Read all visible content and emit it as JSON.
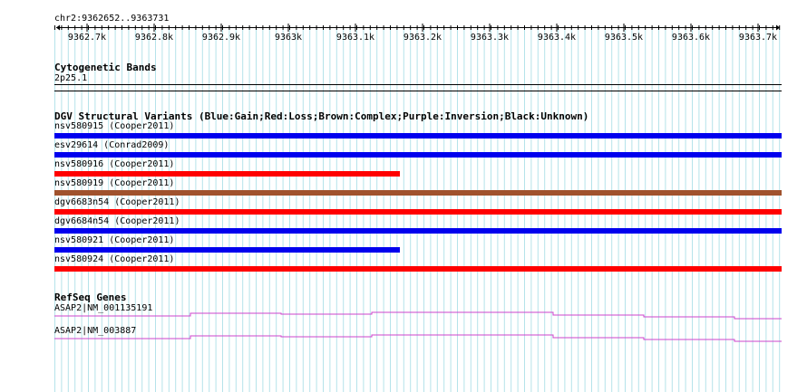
{
  "region": {
    "label": "chr2:9362652..9363731",
    "ticks": [
      "9362.7k",
      "9362.8k",
      "9362.9k",
      "9363k",
      "9363.1k",
      "9363.2k",
      "9363.3k",
      "9363.4k",
      "9363.5k",
      "9363.6k",
      "9363.7k"
    ]
  },
  "cytoband": {
    "title": "Cytogenetic Bands",
    "band": "2p25.1"
  },
  "dgv": {
    "title": "DGV Structural Variants (Blue:Gain;Red:Loss;Brown:Complex;Purple:Inversion;Black:Unknown)",
    "colors": {
      "Gain": "#0000ee",
      "Loss": "#ff0000",
      "Complex": "#a0522d"
    },
    "variants": [
      {
        "label": "nsv580915 (Cooper2011)",
        "type": "Gain",
        "extent": 1.0
      },
      {
        "label": "esv29614 (Conrad2009)",
        "type": "Gain",
        "extent": 1.0
      },
      {
        "label": "nsv580916 (Cooper2011)",
        "type": "Loss",
        "extent": 0.475
      },
      {
        "label": "nsv580919 (Cooper2011)",
        "type": "Complex",
        "extent": 1.0
      },
      {
        "label": "dgv6683n54 (Cooper2011)",
        "type": "Loss",
        "extent": 1.0
      },
      {
        "label": "dgv6684n54 (Cooper2011)",
        "type": "Gain",
        "extent": 1.0
      },
      {
        "label": "nsv580921 (Cooper2011)",
        "type": "Gain",
        "extent": 0.475
      },
      {
        "label": "nsv580924 (Cooper2011)",
        "type": "Loss",
        "extent": 1.0
      }
    ]
  },
  "refseq": {
    "title": "RefSeq Genes",
    "line_color": "#cc44cc",
    "genes": [
      {
        "label": "ASAP2|NM_001135191"
      },
      {
        "label": "ASAP2|NM_003887"
      }
    ]
  }
}
